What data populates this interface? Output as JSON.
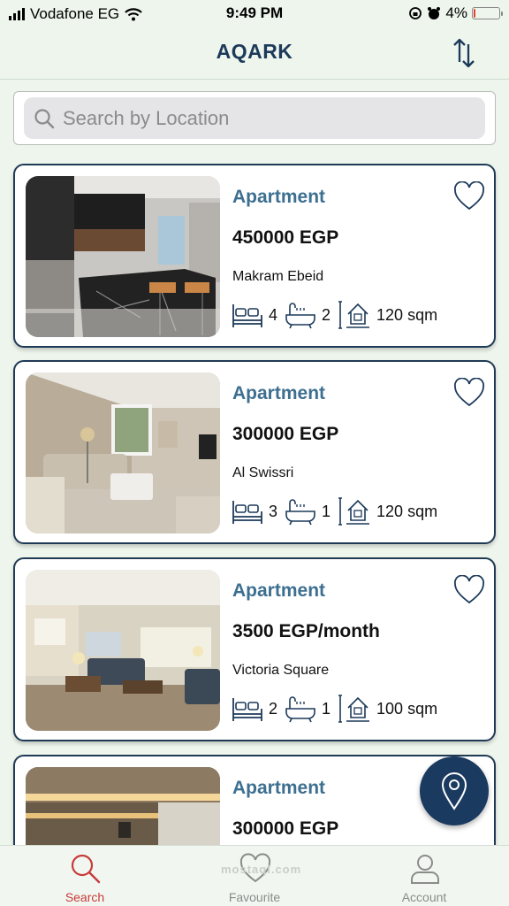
{
  "status_bar": {
    "carrier": "Vodafone EG",
    "time": "9:49 PM",
    "battery_percent": "4%",
    "battery_level": 0.04
  },
  "header": {
    "title": "AQARK",
    "sort_icon": "sort-arrows-icon"
  },
  "search": {
    "placeholder": "Search by Location",
    "icon": "search-icon"
  },
  "listings": [
    {
      "type": "Apartment",
      "price": "450000 EGP",
      "location": "Makram Ebeid",
      "bedrooms": "4",
      "bathrooms": "2",
      "area": "120 sqm"
    },
    {
      "type": "Apartment",
      "price": "300000 EGP",
      "location": "Al Swissri",
      "bedrooms": "3",
      "bathrooms": "1",
      "area": "120 sqm"
    },
    {
      "type": "Apartment",
      "price": "3500 EGP/month",
      "location": "Victoria Square",
      "bedrooms": "2",
      "bathrooms": "1",
      "area": "100 sqm"
    },
    {
      "type": "Apartment",
      "price": "300000 EGP",
      "location": "",
      "bedrooms": "",
      "bathrooms": "",
      "area": ""
    }
  ],
  "map_button": {
    "icon": "map-pin-icon"
  },
  "tabs": [
    {
      "label": "Search",
      "icon": "search-icon",
      "active": true
    },
    {
      "label": "Favourite",
      "icon": "heart-icon",
      "active": false
    },
    {
      "label": "Account",
      "icon": "user-icon",
      "active": false
    }
  ],
  "watermark": "mostaql.com",
  "colors": {
    "brand_navy": "#1d3a5a",
    "type_blue": "#3d6f90",
    "active_tab": "#c83a3a",
    "background": "#edf5ec"
  }
}
